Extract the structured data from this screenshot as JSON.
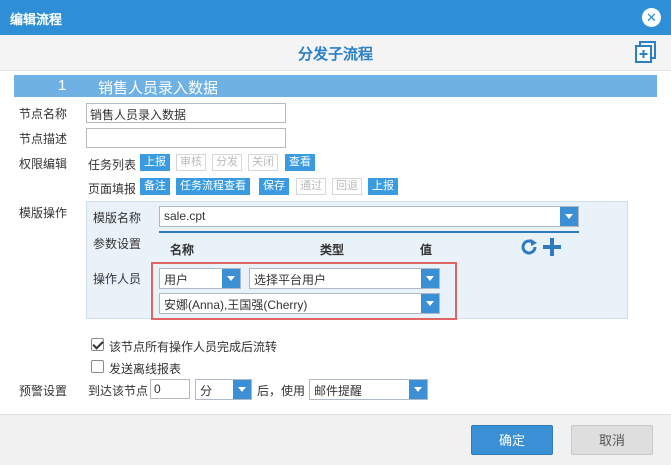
{
  "window": {
    "title": "编辑流程"
  },
  "header": {
    "title": "分发子流程"
  },
  "step": {
    "number": "1",
    "name": "销售人员录入数据"
  },
  "form": {
    "node_name_label": "节点名称",
    "node_name_value": "销售人员录入数据",
    "node_desc_label": "节点描述",
    "node_desc_value": "",
    "permission_label": "权限编辑",
    "task_list_label": "任务列表",
    "task_list_tags": [
      {
        "label": "上报",
        "active": true
      },
      {
        "label": "审核",
        "active": false
      },
      {
        "label": "分发",
        "active": false
      },
      {
        "label": "关闭",
        "active": false
      },
      {
        "label": "查看",
        "active": true
      }
    ],
    "page_fill_label": "页面填报",
    "page_fill_tags": [
      {
        "label": "备注",
        "active": true
      },
      {
        "label": "任务流程查看",
        "active": true
      },
      {
        "label": "保存",
        "active": true
      },
      {
        "label": "通过",
        "active": false
      },
      {
        "label": "回退",
        "active": false
      },
      {
        "label": "上报",
        "active": true
      }
    ],
    "template_ops_label": "模版操作",
    "template_name_label": "模版名称",
    "template_name_value": "sale.cpt",
    "param_label": "参数设置",
    "param_headers": {
      "name": "名称",
      "type": "类型",
      "value": "值"
    },
    "operator_label": "操作人员",
    "operator_type": "用户",
    "operator_source": "选择平台用户",
    "operator_users": "安娜(Anna),王国强(Cherry)",
    "checkbox_all_done": {
      "label": "该节点所有操作人员完成后流转",
      "checked": true
    },
    "checkbox_offline": {
      "label": "发送离线报表",
      "checked": false
    },
    "warning_label": "预警设置",
    "arrive_label": "到达该节点",
    "arrive_value": "0",
    "unit_value": "分",
    "after_use_label": "后，使用",
    "notify_value": "邮件提醒"
  },
  "footer": {
    "ok_label": "确定",
    "cancel_label": "取消"
  },
  "colors": {
    "accent": "#2e8fd6",
    "highlight_box": "#e06666"
  }
}
